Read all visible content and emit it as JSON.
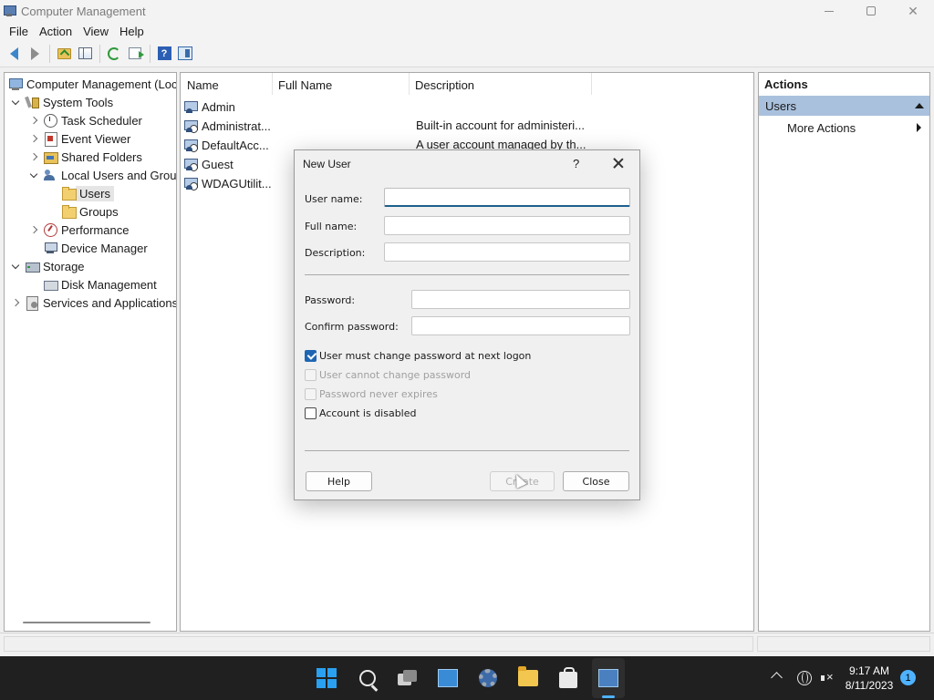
{
  "window": {
    "title": "Computer Management"
  },
  "menu": [
    "File",
    "Action",
    "View",
    "Help"
  ],
  "tree": {
    "root": "Computer Management (Local)",
    "system_tools": "System Tools",
    "task_scheduler": "Task Scheduler",
    "event_viewer": "Event Viewer",
    "shared_folders": "Shared Folders",
    "local_users_groups": "Local Users and Groups",
    "users": "Users",
    "groups": "Groups",
    "performance": "Performance",
    "device_manager": "Device Manager",
    "storage": "Storage",
    "disk_management": "Disk Management",
    "services_apps": "Services and Applications"
  },
  "list": {
    "columns": [
      "Name",
      "Full Name",
      "Description"
    ],
    "rows": [
      {
        "name": "Admin",
        "full_name": "",
        "description": ""
      },
      {
        "name": "Administrat...",
        "full_name": "",
        "description": "Built-in account for administeri..."
      },
      {
        "name": "DefaultAcc...",
        "full_name": "",
        "description": "A user account managed by th..."
      },
      {
        "name": "Guest",
        "full_name": "",
        "description": ""
      },
      {
        "name": "WDAGUtilit...",
        "full_name": "",
        "description": ""
      }
    ]
  },
  "actions": {
    "header": "Actions",
    "section": "Users",
    "more_actions": "More Actions"
  },
  "dialog": {
    "title": "New User",
    "help_glyph": "?",
    "labels": {
      "user_name": "User name:",
      "full_name": "Full name:",
      "description": "Description:",
      "password": "Password:",
      "confirm_password": "Confirm password:"
    },
    "values": {
      "user_name": "",
      "full_name": "",
      "description": "",
      "password": "",
      "confirm_password": ""
    },
    "checkboxes": {
      "must_change": "User must change password at next logon",
      "cannot_change": "User cannot change password",
      "never_expires": "Password never expires",
      "disabled": "Account is disabled"
    },
    "buttons": {
      "help": "Help",
      "create": "Create",
      "close": "Close"
    }
  },
  "taskbar": {
    "time": "9:17 AM",
    "date": "8/11/2023",
    "notification_count": "1"
  }
}
